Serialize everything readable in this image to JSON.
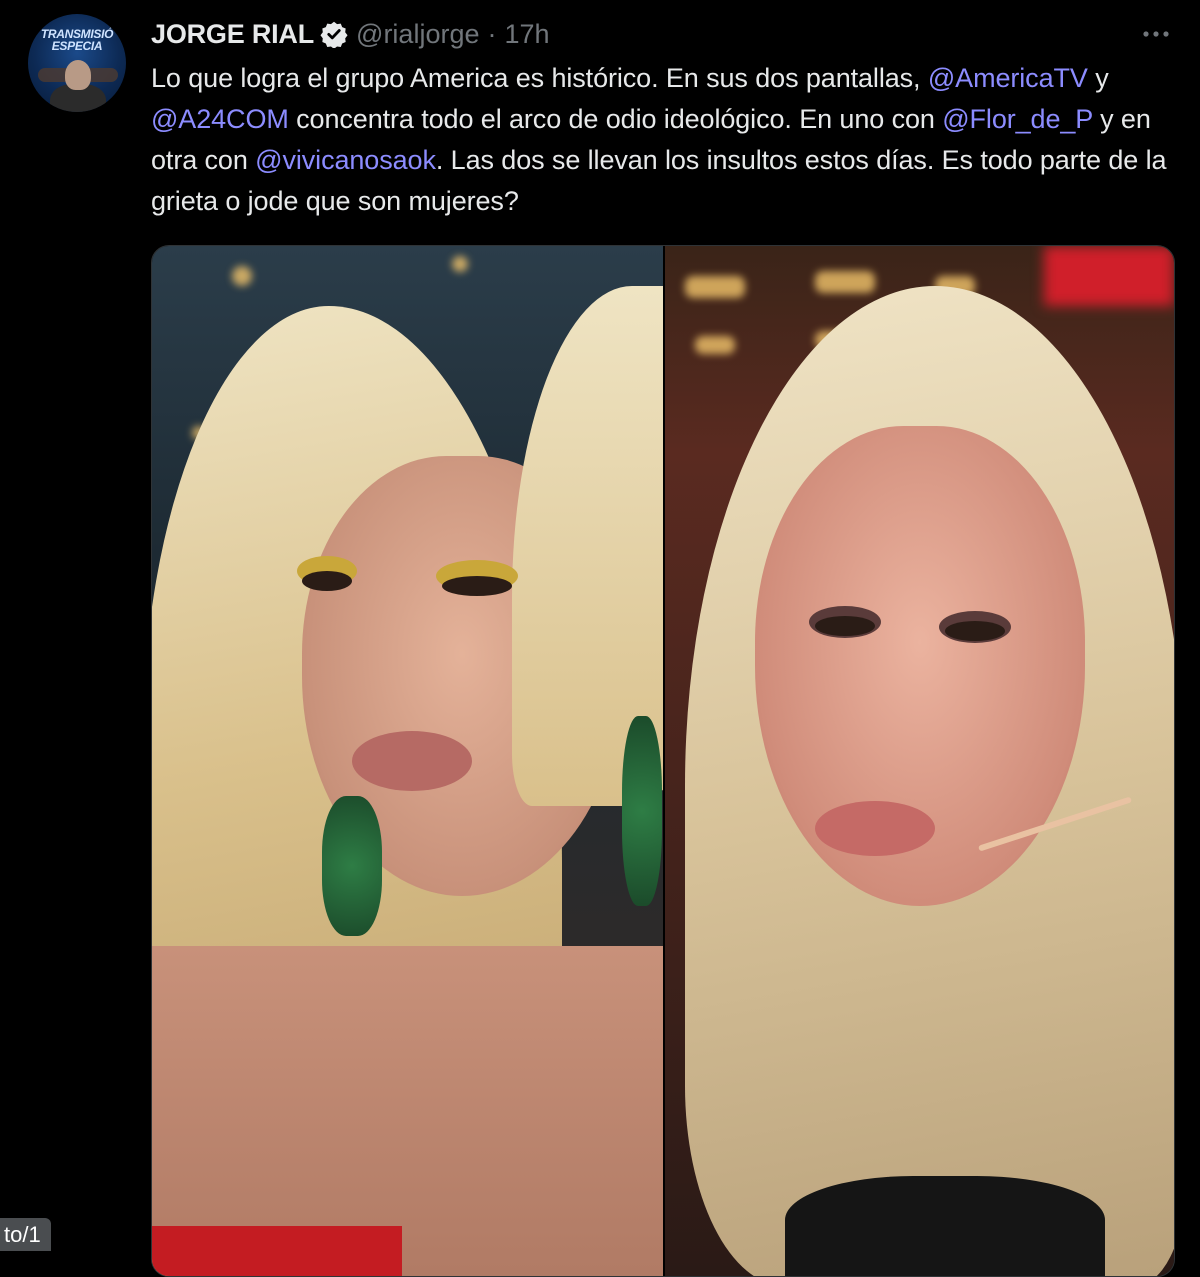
{
  "author": {
    "display_name": "JORGE RIAL",
    "handle": "@rialjorge",
    "separator": "·",
    "time": "17h",
    "avatar_text_line1": "TRANSMISIÓ",
    "avatar_text_line2": "ESPECIA"
  },
  "tweet": {
    "segments": [
      {
        "text": "Lo que logra el grupo America es histórico. En sus dos pantallas, ",
        "mention": false
      },
      {
        "text": "@AmericaTV",
        "mention": true
      },
      {
        "text": " y ",
        "mention": false
      },
      {
        "text": "@A24COM",
        "mention": true
      },
      {
        "text": " concentra todo el arco de odio ideológico. En uno con ",
        "mention": false
      },
      {
        "text": "@Flor_de_P",
        "mention": true
      },
      {
        "text": " y en otra con ",
        "mention": false
      },
      {
        "text": "@vivicanosaok",
        "mention": true
      },
      {
        "text": ". Las dos se llevan los insultos estos días. Es todo parte de la grieta o jode que son mujeres?",
        "mention": false
      }
    ]
  },
  "page_indicator": "to/1",
  "colors": {
    "background": "#000000",
    "text": "#e7e9ea",
    "muted": "#71767b",
    "mention": "#8c8cff",
    "verified": "#e7e9ea"
  },
  "icons": {
    "verified": "verified-badge-icon",
    "more": "more-options-icon"
  }
}
